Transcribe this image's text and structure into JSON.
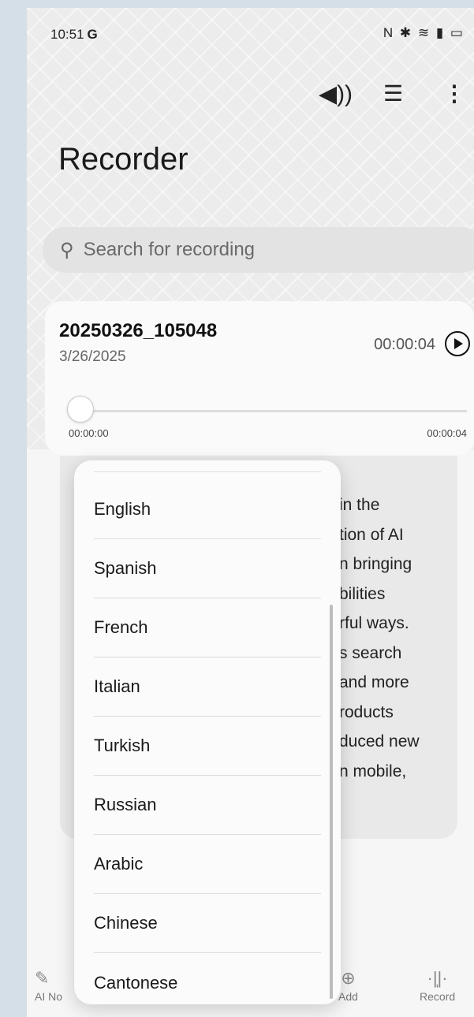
{
  "status": {
    "time": "10:51",
    "carrier": "G",
    "icons": "NFC ✱ WiFi ▮ ▭"
  },
  "toolbar": {
    "speaker_icon": "speaker-icon",
    "sort_icon": "sort-icon",
    "more_icon": "more-icon"
  },
  "app": {
    "title": "Recorder"
  },
  "search": {
    "placeholder": "Search for recording"
  },
  "recording": {
    "name": "20250326_105048",
    "date": "3/26/2025",
    "duration": "00:00:04",
    "position_start": "00:00:00",
    "position_end": "00:00:04",
    "progress": 0
  },
  "summary_fragments": [
    "in the",
    "tion of AI",
    "n bringing",
    "bilities",
    "rful ways.",
    "s search",
    "and more",
    "roducts",
    "duced new",
    "n mobile,"
  ],
  "language_menu": {
    "items": [
      "English",
      "Spanish",
      "French",
      "Italian",
      "Turkish",
      "Russian",
      "Arabic",
      "Chinese",
      "Cantonese"
    ]
  },
  "bottom_nav": {
    "ai_notes": "AI No",
    "add": "Add",
    "record": "Record"
  }
}
